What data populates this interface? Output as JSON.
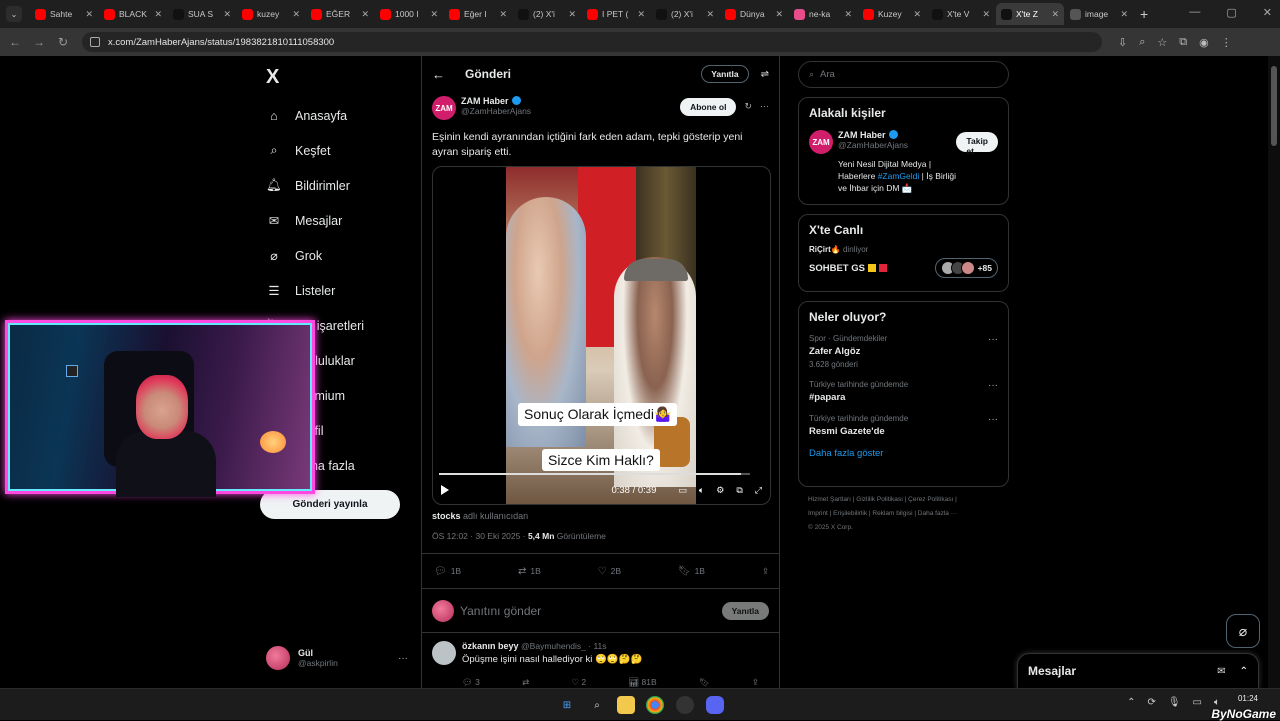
{
  "browser": {
    "tabs": [
      {
        "title": "Sahte",
        "icon": "youtube-icon",
        "color": "#ff0000"
      },
      {
        "title": "BLACK",
        "icon": "youtube-icon",
        "color": "#ff0000"
      },
      {
        "title": "SUA S",
        "icon": "tiktok-icon",
        "color": "#111111"
      },
      {
        "title": "kuzey",
        "icon": "youtube-icon",
        "color": "#ff0000"
      },
      {
        "title": "EĞER",
        "icon": "youtube-icon",
        "color": "#ff0000"
      },
      {
        "title": "1000 I",
        "icon": "youtube-icon",
        "color": "#ff0000"
      },
      {
        "title": "Eğer I",
        "icon": "youtube-icon",
        "color": "#ff0000"
      },
      {
        "title": "(2) X'i",
        "icon": "x-icon",
        "color": "#111111"
      },
      {
        "title": "I PET (",
        "icon": "youtube-icon",
        "color": "#ff0000"
      },
      {
        "title": "(2) X'i",
        "icon": "x-icon",
        "color": "#111111"
      },
      {
        "title": "Dünya",
        "icon": "youtube-icon",
        "color": "#ff0000"
      },
      {
        "title": "ne-ka",
        "icon": "site-icon",
        "color": "#e84d8a"
      },
      {
        "title": "Kuzey",
        "icon": "youtube-icon",
        "color": "#ff0000"
      },
      {
        "title": "X'te V",
        "icon": "x-icon",
        "color": "#111111"
      },
      {
        "title": "X'te Z",
        "icon": "x-icon",
        "color": "#111111",
        "active": true
      },
      {
        "title": "image",
        "icon": "globe-icon",
        "color": "#555555"
      }
    ],
    "url": "x.com/ZamHaberAjans/status/1983821810111058300"
  },
  "sidebar": {
    "logo": "X",
    "items": [
      {
        "label": "Anasayfa",
        "icon": "home-icon"
      },
      {
        "label": "Keşfet",
        "icon": "search-icon"
      },
      {
        "label": "Bildirimler",
        "icon": "bell-icon"
      },
      {
        "label": "Mesajlar",
        "icon": "mail-icon"
      },
      {
        "label": "Grok",
        "icon": "grok-icon"
      },
      {
        "label": "Listeler",
        "icon": "list-icon"
      },
      {
        "label": "Yer işaretleri",
        "icon": "bookmark-icon"
      },
      {
        "label": "Topluluklar",
        "icon": "people-icon"
      },
      {
        "label": "Premium",
        "icon": "x-icon"
      },
      {
        "label": "Profil",
        "icon": "user-icon"
      },
      {
        "label": "Daha fazla",
        "icon": "more-icon"
      }
    ],
    "post_button": "Gönderi yayınla",
    "account": {
      "name": "Gül",
      "handle": "@askpirlin"
    }
  },
  "main": {
    "title": "Gönderi",
    "reply_pill": "Yanıtla",
    "post": {
      "author_name": "ZAM Haber",
      "author_handle": "@ZamHaberAjans",
      "avatar_text": "ZAM",
      "subscribe_label": "Abone ol",
      "text": "Eşinin kendi ayranından içtiğini fark eden adam, tepki gösterip yeni ayran sipariş etti.",
      "video": {
        "caption1": "Sonuç Olarak İçmedi🤷‍♀️",
        "caption2": "Sizce Kim Haklı?",
        "time": "0:38 / 0:39",
        "progress": 0.97
      },
      "source_user": "stocks",
      "source_suffix": "adlı kullanıcıdan",
      "time": "ÖS 12:02 · 30 Eki 2025 ·",
      "views": "5,4 Mn",
      "views_label": "Görüntüleme",
      "stats": {
        "replies": "1B",
        "reposts": "1B",
        "likes": "2B",
        "bookmarks": "1B"
      }
    },
    "reply_placeholder": "Yanıtını gönder",
    "reply_button": "Yanıtla",
    "comment": {
      "name": "özkanın beyy",
      "handle": "@Baymuhendis_ · 11s",
      "text": "Öpüşme işini nasıl hallediyor ki 🙄🙄🤔🤔",
      "replies": "3",
      "likes": "2",
      "views": "81B"
    }
  },
  "right": {
    "search_placeholder": "Ara",
    "related_title": "Alakalı kişiler",
    "related": {
      "name": "ZAM Haber",
      "handle": "@ZamHaberAjans",
      "follow": "Takip et",
      "bio_text": "Yeni Nesil Dijital Medya | Haberlere",
      "bio_tag": "#ZamGeldi",
      "bio_rest": "| İş Birliği ve İhbar için DM 📩"
    },
    "live_title": "X'te Canlı",
    "live": {
      "host": "RiÇirt🔥",
      "host_suffix": "dinliyor",
      "topic": "SOHBET GS",
      "count": "+85"
    },
    "trends_title": "Neler oluyor?",
    "trends": [
      {
        "category": "Spor · Gündemdekiler",
        "title": "Zafer Algöz",
        "count": "3.628 gönderi"
      },
      {
        "category": "Türkiye tarihinde gündemde",
        "title": "#papara",
        "count": ""
      },
      {
        "category": "Türkiye tarihinde gündemde",
        "title": "Resmi Gazete'de",
        "count": ""
      }
    ],
    "show_more": "Daha fazla göster",
    "footer_line1": "Hizmet Şartları | Gizlilik Politikası | Çerez Politikası |",
    "footer_line2": "Imprint | Erişilebilirlik | Reklam bilgisi | Daha fazla ···",
    "footer_line3": "© 2025 X Corp."
  },
  "messages_dock": "Mesajlar",
  "taskbar": {
    "time": "01:24",
    "watermark": "ByNoGame"
  }
}
